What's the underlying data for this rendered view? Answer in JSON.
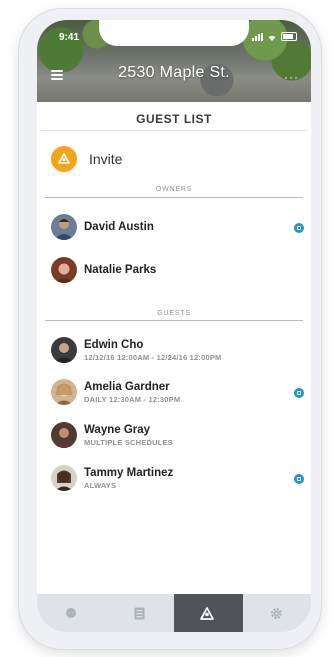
{
  "status_bar": {
    "time": "9:41"
  },
  "header": {
    "title": "2530 Maple St.",
    "more_label": "···"
  },
  "page": {
    "title": "GUEST LIST",
    "invite_label": "Invite"
  },
  "sections": {
    "owners": "OWNERS",
    "guests": "GUESTS"
  },
  "owners": [
    {
      "name": "David Austin",
      "badge": true
    },
    {
      "name": "Natalie Parks",
      "badge": false
    }
  ],
  "guests": [
    {
      "name": "Edwin Cho",
      "schedule": "12/12/16 12:00AM - 12/24/16 12:00PM",
      "badge": false
    },
    {
      "name": "Amelia Gardner",
      "schedule": "DAILY 12:30AM - 12:30PM",
      "badge": true
    },
    {
      "name": "Wayne Gray",
      "schedule": "MULTIPLE SCHEDULES",
      "badge": false
    },
    {
      "name": "Tammy Martinez",
      "schedule": "ALWAYS",
      "badge": true
    }
  ],
  "tabs": [
    {
      "icon": "circle-icon",
      "active": false
    },
    {
      "icon": "list-icon",
      "active": false
    },
    {
      "icon": "guests-icon",
      "active": true
    },
    {
      "icon": "gear-icon",
      "active": false
    }
  ],
  "colors": {
    "accent": "#f2a51a",
    "badge": "#1f95c9",
    "active_tab": "#505357",
    "tabbar": "#dfe2e6"
  }
}
